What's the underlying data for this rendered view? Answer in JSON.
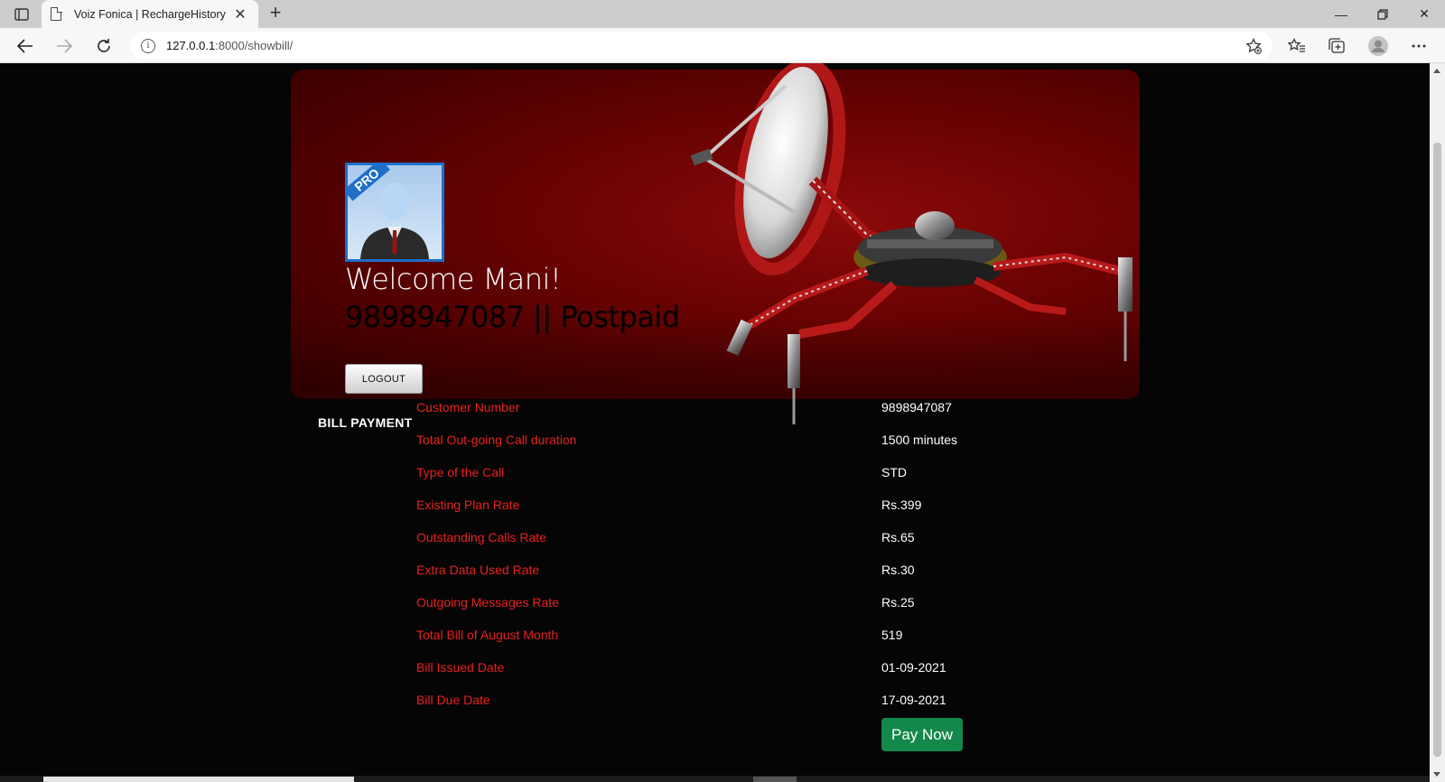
{
  "browser": {
    "tab_title": "Voiz Fonica | RechargeHistory",
    "url_host": "127.0.0.1",
    "url_rest": ":8000/showbill/"
  },
  "header": {
    "welcome": "Welcome Mani!",
    "number_line": "9898947087 || Postpaid",
    "logout_label": "LOGOUT",
    "avatar_badge": "PRO"
  },
  "bill": {
    "section_label": "BILL PAYMENT",
    "rows": [
      {
        "label": "Customer Number",
        "value": "9898947087"
      },
      {
        "label": "Total Out-going Call duration",
        "value": "1500 minutes"
      },
      {
        "label": "Type of the Call",
        "value": "STD"
      },
      {
        "label": "Existing Plan Rate",
        "value": "Rs.399"
      },
      {
        "label": "Outstanding Calls Rate",
        "value": "Rs.65"
      },
      {
        "label": "Extra Data Used Rate",
        "value": "Rs.30"
      },
      {
        "label": "Outgoing Messages Rate",
        "value": "Rs.25"
      },
      {
        "label": "Total Bill of August Month",
        "value": "519"
      },
      {
        "label": "Bill Issued Date",
        "value": "01-09-2021"
      },
      {
        "label": "Bill Due Date",
        "value": "17-09-2021"
      }
    ],
    "pay_label": "Pay Now"
  },
  "colors": {
    "label_red": "#e8201e",
    "pay_green": "#14884a",
    "banner_red": "#7a0505"
  }
}
